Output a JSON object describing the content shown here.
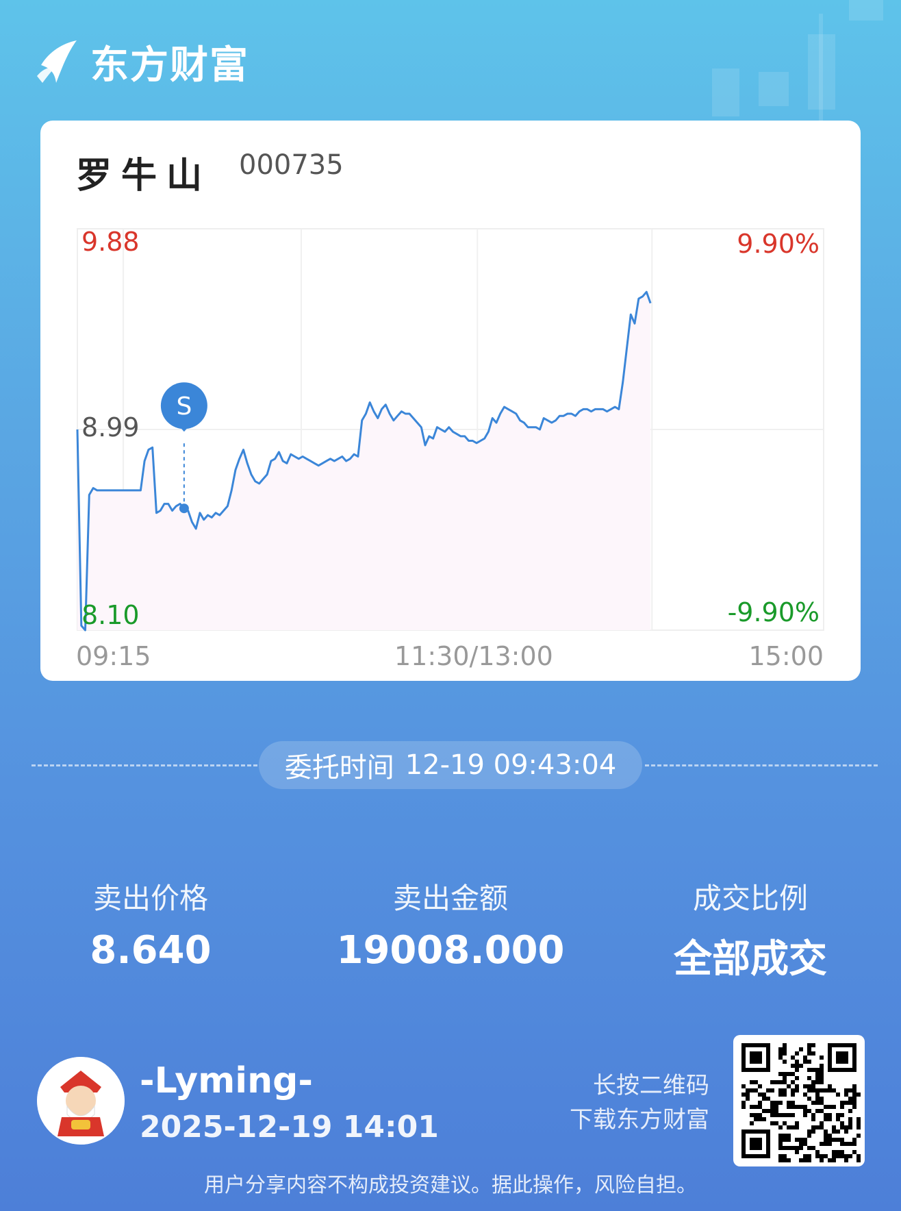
{
  "brand": {
    "name": "东方财富"
  },
  "stock": {
    "name": "罗牛山",
    "code": "000735"
  },
  "chart_data": {
    "type": "line",
    "title": "",
    "y_left_top": "9.88",
    "y_left_mid": "8.99",
    "y_left_bottom": "8.10",
    "y_right_top": "9.90%",
    "y_right_bottom": "-9.90%",
    "x_labels": [
      "09:15",
      "11:30/13:00",
      "15:00"
    ],
    "ylim": [
      8.1,
      9.88
    ],
    "prev_close": 8.99,
    "marker": {
      "label": "S",
      "time": "09:43",
      "price": 8.64
    },
    "series": [
      {
        "values": [
          8.99,
          8.12,
          8.1,
          8.7,
          8.73,
          8.72,
          8.72,
          8.72,
          8.72,
          8.72,
          8.72,
          8.72,
          8.72,
          8.72,
          8.72,
          8.72,
          8.72,
          8.85,
          8.9,
          8.91,
          8.62,
          8.63,
          8.66,
          8.66,
          8.63,
          8.65,
          8.66,
          8.64,
          8.63,
          8.58,
          8.55,
          8.62,
          8.59,
          8.61,
          8.6,
          8.62,
          8.61,
          8.63,
          8.65,
          8.72,
          8.81,
          8.86,
          8.9,
          8.84,
          8.79,
          8.76,
          8.75,
          8.77,
          8.79,
          8.85,
          8.86,
          8.89,
          8.85,
          8.84,
          8.88,
          8.87,
          8.86,
          8.87,
          8.86,
          8.85,
          8.84,
          8.83,
          8.84,
          8.85,
          8.86,
          8.85,
          8.86,
          8.87,
          8.85,
          8.86,
          8.88,
          8.87,
          9.03,
          9.06,
          9.11,
          9.07,
          9.04,
          9.08,
          9.1,
          9.06,
          9.03,
          9.05,
          9.07,
          9.06,
          9.06,
          9.04,
          9.02,
          9.0,
          8.92,
          8.96,
          8.95,
          9.0,
          8.99,
          8.98,
          9.0,
          8.98,
          8.97,
          8.96,
          8.96,
          8.94,
          8.94,
          8.93,
          8.94,
          8.95,
          8.98,
          9.04,
          9.02,
          9.06,
          9.09,
          9.08,
          9.07,
          9.06,
          9.03,
          9.02,
          9.0,
          9.0,
          9.0,
          8.99,
          9.04,
          9.03,
          9.02,
          9.03,
          9.05,
          9.05,
          9.06,
          9.06,
          9.05,
          9.07,
          9.08,
          9.08,
          9.07,
          9.08,
          9.08,
          9.08,
          9.07,
          9.08,
          9.09,
          9.08,
          9.2,
          9.35,
          9.5,
          9.46,
          9.57,
          9.58,
          9.6,
          9.55
        ],
        "note": ""
      }
    ],
    "grid": true
  },
  "order": {
    "label": "委托时间",
    "time": "12-19 09:43:04"
  },
  "stats": [
    {
      "label": "卖出价格",
      "value": "8.640"
    },
    {
      "label": "卖出金额",
      "value": "19008.000"
    },
    {
      "label": "成交比例",
      "value": "全部成交"
    }
  ],
  "user": {
    "name": "-Lyming-",
    "share_time": "2025-12-19 14:01"
  },
  "qr": {
    "hint_line1": "长按二维码",
    "hint_line2": "下载东方财富"
  },
  "disclaimer": "用户分享内容不构成投资建议。据此操作，风险自担。",
  "colors": {
    "up": "#d9362b",
    "down": "#1a9a2a",
    "line": "#3b86d8",
    "fill": "#fdf6fb"
  }
}
